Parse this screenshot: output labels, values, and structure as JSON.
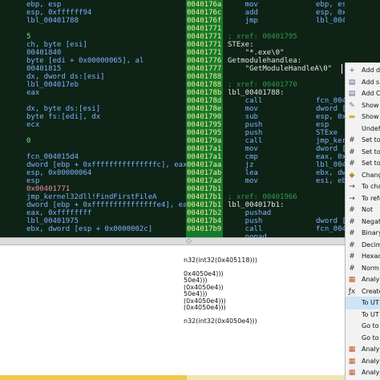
{
  "left_lines": [
    {
      "t": "ebp, esp",
      "c": "c-blue"
    },
    {
      "t": "esp, 0xffffff94",
      "c": "c-blue"
    },
    {
      "t": "lbl_00401788",
      "c": "c-blue"
    },
    {
      "t": "",
      "c": "c-blue"
    },
    {
      "t": "5",
      "c": "c-green"
    },
    {
      "t": "ch, byte [esi]",
      "c": "c-blue"
    },
    {
      "t": "00401840",
      "c": "c-blue"
    },
    {
      "t": "byte [edi + 0x00000065], al",
      "c": "c-blue"
    },
    {
      "t": "00401815",
      "c": "c-blue"
    },
    {
      "t": "dx, dword ds:[esi]",
      "c": "c-blue"
    },
    {
      "t": "lbl_004017eb",
      "c": "c-blue"
    },
    {
      "t": "eax",
      "c": "c-blue"
    },
    {
      "t": "",
      "c": "c-blue"
    },
    {
      "t": "dx, byte ds:[esi]",
      "c": "c-blue"
    },
    {
      "t": "byte fs:[edi], dx",
      "c": "c-blue"
    },
    {
      "t": "ecx",
      "c": "c-blue"
    },
    {
      "t": "",
      "c": "c-blue"
    },
    {
      "t": "0",
      "c": "c-green"
    },
    {
      "t": "",
      "c": "c-blue"
    },
    {
      "t": "fcn_004015d4",
      "c": "c-blue"
    },
    {
      "t": "dword [ebp + 0xfffffffffffffffc], eax",
      "c": "c-blue"
    },
    {
      "t": "esp, 0x00000064",
      "c": "c-blue"
    },
    {
      "t": "esp",
      "c": "c-blue"
    },
    {
      "t": "0x00401771",
      "c": "c-pink"
    },
    {
      "t": "jmp_kernel32dll!FindFirstFileA",
      "c": "c-blue"
    },
    {
      "t": "dword [ebp + 0xfffffffffffffffe4], eax",
      "c": "c-blue"
    },
    {
      "t": "eax, 0xffffffff",
      "c": "c-blue"
    },
    {
      "t": "lbl_00401975",
      "c": "c-blue"
    },
    {
      "t": "ebx, dword [esp + 0x0000002c]",
      "c": "c-blue"
    }
  ],
  "addresses": [
    "0040176a",
    "0040176c",
    "0040176f",
    "00401771",
    "00401771",
    "00401771",
    "00401771",
    "00401776",
    "00401777",
    "00401788",
    "00401788",
    "0040178b",
    "0040178d",
    "0040178e",
    "00401790",
    "00401795",
    "00401795",
    "0040179a",
    "004017a1",
    "004017a1",
    "004017aa",
    "004017ab",
    "004017ad",
    "004017b1",
    "004017b1",
    "004017b1",
    "004017b2",
    "004017b4",
    "004017b9"
  ],
  "right_lines": [
    {
      "t": "    mov",
      "c": "c-blue"
    },
    {
      "t": "    add",
      "c": "c-blue"
    },
    {
      "t": "    jmp",
      "c": "c-blue"
    },
    {
      "t": "",
      "c": "c-blue"
    },
    {
      "t": "; xref: 00401795",
      "c": "c-dgreen"
    },
    {
      "t": "STExe:",
      "c": "c-white"
    },
    {
      "t": "    \"*.exe\\0\"",
      "c": "c-white"
    },
    {
      "t": "Getmodulehandlea:",
      "c": "c-white"
    },
    {
      "t": "    \"GetModuleHandleA\\0\"",
      "c": "c-white"
    },
    {
      "t": "",
      "c": "c-blue"
    },
    {
      "t": "; xref: 00401770",
      "c": "c-dgreen"
    },
    {
      "t": "lbl_00401788:",
      "c": "c-white"
    },
    {
      "t": "    call",
      "c": "c-blue"
    },
    {
      "t": "    mov",
      "c": "c-blue"
    },
    {
      "t": "    sub",
      "c": "c-blue"
    },
    {
      "t": "    push",
      "c": "c-blue"
    },
    {
      "t": "    push",
      "c": "c-blue"
    },
    {
      "t": "    call",
      "c": "c-blue"
    },
    {
      "t": "    mov",
      "c": "c-blue"
    },
    {
      "t": "    cmp",
      "c": "c-blue"
    },
    {
      "t": "    jz",
      "c": "c-blue"
    },
    {
      "t": "    lea",
      "c": "c-blue"
    },
    {
      "t": "    mov",
      "c": "c-blue"
    },
    {
      "t": "",
      "c": "c-blue"
    },
    {
      "t": "; xref: 00401966",
      "c": "c-dgreen"
    },
    {
      "t": "lbl_004017b1:",
      "c": "c-white"
    },
    {
      "t": "    pushad",
      "c": "c-blue"
    },
    {
      "t": "    push",
      "c": "c-blue"
    },
    {
      "t": "    call",
      "c": "c-blue"
    },
    {
      "t": "    popad",
      "c": "c-blue"
    }
  ],
  "right_operands": [
    {
      "t": "ebp, esp",
      "row": 0
    },
    {
      "t": "esp, 0xf",
      "row": 1
    },
    {
      "t": "lbl_0040",
      "row": 2
    },
    {
      "t": "fcn_0040",
      "row": 12
    },
    {
      "t": "dword [e",
      "row": 13
    },
    {
      "t": "esp, 0x0",
      "row": 14
    },
    {
      "t": "esp",
      "row": 15
    },
    {
      "t": "STExe",
      "row": 16
    },
    {
      "t": "jmp_kern",
      "row": 17
    },
    {
      "t": "dword [e",
      "row": 18
    },
    {
      "t": "eax, 0xf",
      "row": 19
    },
    {
      "t": "lbl_0040",
      "row": 20
    },
    {
      "t": "ebx, dwo",
      "row": 21
    },
    {
      "t": "esi, ebx",
      "row": 22
    },
    {
      "t": "dword [e",
      "row": 27
    },
    {
      "t": "fcn_0040",
      "row": 28
    }
  ],
  "bottom_lines": [
    {
      "t": "n32(int32(0x405118)))",
      "row": 1
    },
    {
      "t": "0x4050e4)))",
      "row": 3
    },
    {
      "t": "50e4)))",
      "row": 4
    },
    {
      "t": "(0x4050e4))",
      "row": 5
    },
    {
      "t": "50e4)))",
      "row": 6
    },
    {
      "t": "(0x4050e4)))",
      "row": 7
    },
    {
      "t": "(0x4050e4)))",
      "row": 8
    },
    {
      "t": "n32(int32(0x4050e4)))",
      "row": 10
    }
  ],
  "menu": {
    "items": [
      {
        "label": "Add d",
        "icon": "+",
        "icon_name": "add-icon",
        "color": "#2c62c9"
      },
      {
        "label": "Add s",
        "icon": "▤",
        "icon_name": "add-structure-icon",
        "color": "#5a6f8e"
      },
      {
        "label": "Add C",
        "icon": "▤",
        "icon_name": "add-comment-icon",
        "color": "#5a6f8e"
      },
      {
        "label": "Show",
        "icon": "✎",
        "icon_name": "show-edit-icon",
        "color": "#3a7bd5"
      },
      {
        "label": "Show",
        "icon": "▬",
        "icon_name": "folder-icon",
        "color": "#d8b13a"
      },
      {
        "label": "Undef",
        "icon": "",
        "icon_name": "blank-icon",
        "color": "#333"
      },
      {
        "label": "Set to",
        "icon": "#",
        "icon_name": "hash-icon",
        "color": "#333"
      },
      {
        "label": "Set to",
        "icon": "#",
        "icon_name": "hash-icon",
        "color": "#333"
      },
      {
        "label": "Set to",
        "icon": "#",
        "icon_name": "hash-icon",
        "color": "#333"
      },
      {
        "label": "Chang",
        "icon": "◆",
        "icon_name": "change-icon",
        "color": "#b88a2a"
      },
      {
        "label": "To cha",
        "icon": "→",
        "icon_name": "arrow-right-icon",
        "color": "#333"
      },
      {
        "label": "To refe",
        "icon": "→",
        "icon_name": "arrow-right-icon",
        "color": "#333"
      },
      {
        "label": "Not",
        "icon": "#",
        "icon_name": "hash-icon",
        "color": "#333"
      },
      {
        "label": "Negat",
        "icon": "#",
        "icon_name": "hash-icon",
        "color": "#333"
      },
      {
        "label": "Binary",
        "icon": "#",
        "icon_name": "hash-icon",
        "color": "#333"
      },
      {
        "label": "Decim",
        "icon": "#",
        "icon_name": "hash-icon",
        "color": "#333"
      },
      {
        "label": "Hexac",
        "icon": "#",
        "icon_name": "hash-icon",
        "color": "#333"
      },
      {
        "label": "Norm",
        "icon": "#",
        "icon_name": "hash-icon",
        "color": "#333"
      },
      {
        "label": "Analy",
        "icon": "▦",
        "icon_name": "analyze-icon",
        "color": "#c8553d"
      },
      {
        "label": "Create",
        "icon": "ƒx",
        "icon_name": "function-icon",
        "color": "#333"
      },
      {
        "label": "To UT",
        "icon": "",
        "icon_name": "blank-icon",
        "color": "#333",
        "selected": true
      },
      {
        "label": "To UT",
        "icon": "",
        "icon_name": "blank-icon",
        "color": "#333"
      },
      {
        "label": "Go to",
        "icon": "",
        "icon_name": "blank-icon",
        "color": "#333"
      },
      {
        "label": "Go to",
        "icon": "",
        "icon_name": "blank-icon",
        "color": "#333"
      },
      {
        "label": "Analy",
        "icon": "▦",
        "icon_name": "analyze-icon",
        "color": "#c8553d"
      },
      {
        "label": "Analy",
        "icon": "▦",
        "icon_name": "analyze-icon",
        "color": "#c8553d"
      },
      {
        "label": "Analy",
        "icon": "▦",
        "icon_name": "analyze-icon",
        "color": "#c8553d"
      }
    ]
  },
  "split_arrow": "◇"
}
